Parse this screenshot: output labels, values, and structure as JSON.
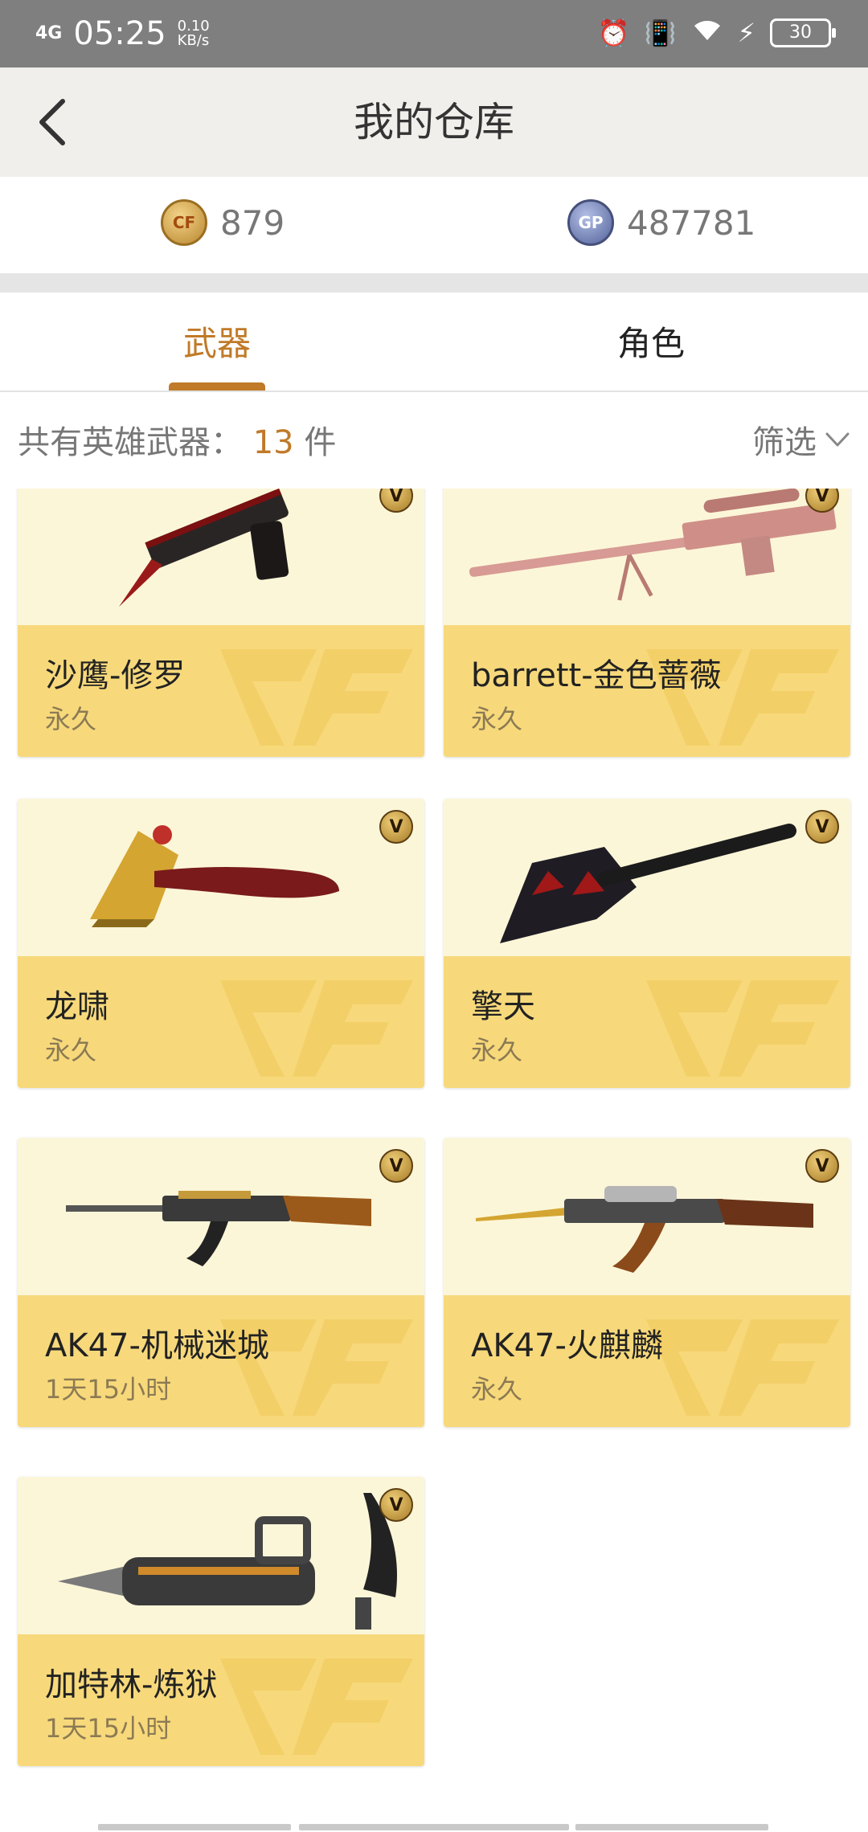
{
  "status_bar": {
    "network": "4G",
    "time": "05:25",
    "speed_value": "0.10",
    "speed_unit": "KB/s",
    "battery": "30"
  },
  "header": {
    "title": "我的仓库"
  },
  "currency": {
    "cf_points": "879",
    "gp_points": "487781",
    "gp_label": "GP"
  },
  "tabs": [
    {
      "label": "武器",
      "active": true
    },
    {
      "label": "角色",
      "active": false
    }
  ],
  "summary": {
    "prefix": "共有英雄武器：",
    "count": "13",
    "suffix": "件",
    "filter_label": "筛选"
  },
  "badge_letter": "V",
  "weapons": [
    {
      "name": "沙鹰-修罗",
      "duration": "永久"
    },
    {
      "name": "barrett-金色蔷薇",
      "duration": "永久"
    },
    {
      "name": "龙啸",
      "duration": "永久"
    },
    {
      "name": "擎天",
      "duration": "永久"
    },
    {
      "name": "AK47-机械迷城",
      "duration": "1天15小时"
    },
    {
      "name": "AK47-火麒麟",
      "duration": "永久"
    },
    {
      "name": "加特林-炼狱",
      "duration": "1天15小时"
    }
  ],
  "colors": {
    "accent": "#c07a28",
    "card_top": "#fcf6d8",
    "card_bottom": "#f7d97b",
    "status_bar": "#7f7f7f",
    "header_bg": "#f1efeb"
  }
}
